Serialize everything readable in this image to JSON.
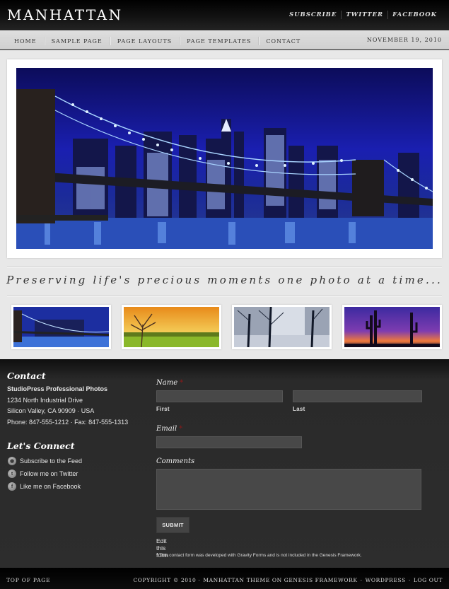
{
  "header": {
    "logo": "MANHATTAN",
    "top_links": [
      "SUBSCRIBE",
      "TWITTER",
      "FACEBOOK"
    ]
  },
  "nav": {
    "items": [
      "HOME",
      "SAMPLE PAGE",
      "PAGE LAYOUTS",
      "PAGE TEMPLATES",
      "CONTACT"
    ],
    "date": "NOVEMBER 19, 2010"
  },
  "hero": {
    "image": "brooklyn-bridge-night-skyline"
  },
  "tagline": "Preserving life's precious moments one photo at a time...",
  "thumbnails": [
    {
      "image": "brooklyn-bridge-night"
    },
    {
      "image": "tree-sunset-vineyard"
    },
    {
      "image": "winter-trees-fog"
    },
    {
      "image": "desert-cactus-sunset"
    }
  ],
  "contact": {
    "title": "Contact",
    "company": "StudioPress Professional Photos",
    "address1": "1234 North Industrial Drive",
    "address2": "Silicon Valley, CA 90909 · USA",
    "phone": "Phone: 847-555-1212 · Fax: 847-555-1313"
  },
  "connect": {
    "title": "Let's Connect",
    "items": [
      {
        "icon": "rss-icon",
        "label": "Subscribe to the Feed"
      },
      {
        "icon": "twitter-icon",
        "label": "Follow me on Twitter"
      },
      {
        "icon": "facebook-icon",
        "label": "Like me on Facebook"
      }
    ]
  },
  "form": {
    "name_label": "Name",
    "required_mark": "*",
    "first_label": "First",
    "last_label": "Last",
    "first_value": "",
    "last_value": "",
    "email_label": "Email",
    "email_value": "",
    "comments_label": "Comments",
    "comments_value": "",
    "submit_label": "SUBMIT",
    "edit_link": "Edit this form",
    "note": "* This contact form was developed with Gravity Forms and is not included in the Genesis Framework."
  },
  "footer": {
    "top_link": "TOP OF PAGE",
    "copyright": "COPYRIGHT © 2010 ·",
    "theme_link": "MANHATTAN THEME ON GENESIS FRAMEWORK",
    "sep": "·",
    "wordpress_link": "WORDPRESS",
    "logout_link": "LOG OUT"
  }
}
